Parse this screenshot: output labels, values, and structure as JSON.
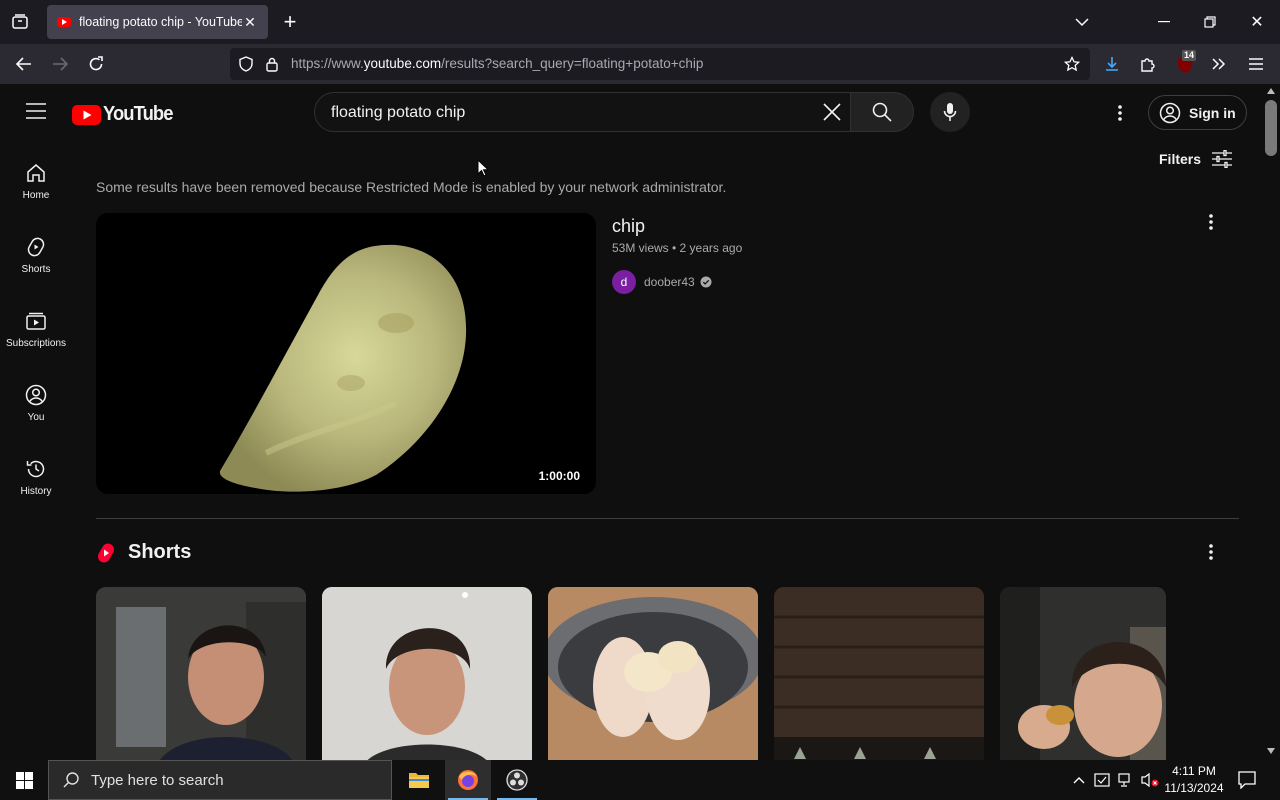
{
  "browser": {
    "tab_title": "floating potato chip - YouTube",
    "url_prefix": "https://www.",
    "url_domain": "youtube.com",
    "url_path": "/results?search_query=floating+potato+chip",
    "extension_badge": "14"
  },
  "youtube": {
    "logo_text": "YouTube",
    "search_query": "floating potato chip",
    "signin_label": "Sign in",
    "filters_label": "Filters",
    "sidebar": [
      {
        "label": "Home",
        "icon": "home-icon"
      },
      {
        "label": "Shorts",
        "icon": "shorts-icon"
      },
      {
        "label": "Subscriptions",
        "icon": "subscriptions-icon"
      },
      {
        "label": "You",
        "icon": "you-icon"
      },
      {
        "label": "History",
        "icon": "history-icon"
      }
    ],
    "restricted_note": "Some results have been removed because Restricted Mode is enabled by your network administrator.",
    "result": {
      "title": "chip",
      "meta": "53M views • 2 years ago",
      "channel": "doober43",
      "channel_initial": "d",
      "duration": "1:00:00"
    },
    "shorts_title": "Shorts"
  },
  "taskbar": {
    "search_placeholder": "Type here to search",
    "time": "4:11 PM",
    "date": "11/13/2024"
  },
  "colors": {
    "accent_red": "#ff0000",
    "page_bg": "#0f0f0f",
    "taskbar_active": "#76b9ed"
  }
}
